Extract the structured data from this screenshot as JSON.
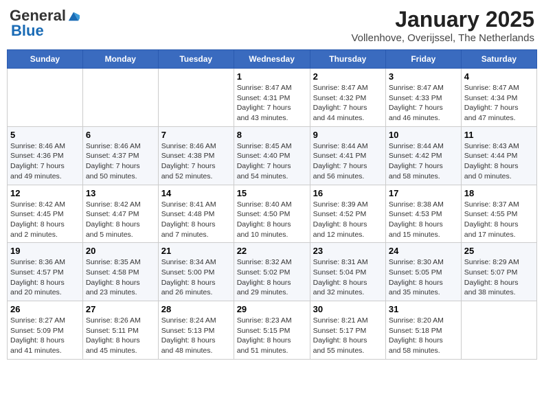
{
  "header": {
    "logo_general": "General",
    "logo_blue": "Blue",
    "title": "January 2025",
    "subtitle": "Vollenhove, Overijssel, The Netherlands"
  },
  "days_of_week": [
    "Sunday",
    "Monday",
    "Tuesday",
    "Wednesday",
    "Thursday",
    "Friday",
    "Saturday"
  ],
  "weeks": [
    [
      {
        "day": "",
        "info": ""
      },
      {
        "day": "",
        "info": ""
      },
      {
        "day": "",
        "info": ""
      },
      {
        "day": "1",
        "info": "Sunrise: 8:47 AM\nSunset: 4:31 PM\nDaylight: 7 hours\nand 43 minutes."
      },
      {
        "day": "2",
        "info": "Sunrise: 8:47 AM\nSunset: 4:32 PM\nDaylight: 7 hours\nand 44 minutes."
      },
      {
        "day": "3",
        "info": "Sunrise: 8:47 AM\nSunset: 4:33 PM\nDaylight: 7 hours\nand 46 minutes."
      },
      {
        "day": "4",
        "info": "Sunrise: 8:47 AM\nSunset: 4:34 PM\nDaylight: 7 hours\nand 47 minutes."
      }
    ],
    [
      {
        "day": "5",
        "info": "Sunrise: 8:46 AM\nSunset: 4:36 PM\nDaylight: 7 hours\nand 49 minutes."
      },
      {
        "day": "6",
        "info": "Sunrise: 8:46 AM\nSunset: 4:37 PM\nDaylight: 7 hours\nand 50 minutes."
      },
      {
        "day": "7",
        "info": "Sunrise: 8:46 AM\nSunset: 4:38 PM\nDaylight: 7 hours\nand 52 minutes."
      },
      {
        "day": "8",
        "info": "Sunrise: 8:45 AM\nSunset: 4:40 PM\nDaylight: 7 hours\nand 54 minutes."
      },
      {
        "day": "9",
        "info": "Sunrise: 8:44 AM\nSunset: 4:41 PM\nDaylight: 7 hours\nand 56 minutes."
      },
      {
        "day": "10",
        "info": "Sunrise: 8:44 AM\nSunset: 4:42 PM\nDaylight: 7 hours\nand 58 minutes."
      },
      {
        "day": "11",
        "info": "Sunrise: 8:43 AM\nSunset: 4:44 PM\nDaylight: 8 hours\nand 0 minutes."
      }
    ],
    [
      {
        "day": "12",
        "info": "Sunrise: 8:42 AM\nSunset: 4:45 PM\nDaylight: 8 hours\nand 2 minutes."
      },
      {
        "day": "13",
        "info": "Sunrise: 8:42 AM\nSunset: 4:47 PM\nDaylight: 8 hours\nand 5 minutes."
      },
      {
        "day": "14",
        "info": "Sunrise: 8:41 AM\nSunset: 4:48 PM\nDaylight: 8 hours\nand 7 minutes."
      },
      {
        "day": "15",
        "info": "Sunrise: 8:40 AM\nSunset: 4:50 PM\nDaylight: 8 hours\nand 10 minutes."
      },
      {
        "day": "16",
        "info": "Sunrise: 8:39 AM\nSunset: 4:52 PM\nDaylight: 8 hours\nand 12 minutes."
      },
      {
        "day": "17",
        "info": "Sunrise: 8:38 AM\nSunset: 4:53 PM\nDaylight: 8 hours\nand 15 minutes."
      },
      {
        "day": "18",
        "info": "Sunrise: 8:37 AM\nSunset: 4:55 PM\nDaylight: 8 hours\nand 17 minutes."
      }
    ],
    [
      {
        "day": "19",
        "info": "Sunrise: 8:36 AM\nSunset: 4:57 PM\nDaylight: 8 hours\nand 20 minutes."
      },
      {
        "day": "20",
        "info": "Sunrise: 8:35 AM\nSunset: 4:58 PM\nDaylight: 8 hours\nand 23 minutes."
      },
      {
        "day": "21",
        "info": "Sunrise: 8:34 AM\nSunset: 5:00 PM\nDaylight: 8 hours\nand 26 minutes."
      },
      {
        "day": "22",
        "info": "Sunrise: 8:32 AM\nSunset: 5:02 PM\nDaylight: 8 hours\nand 29 minutes."
      },
      {
        "day": "23",
        "info": "Sunrise: 8:31 AM\nSunset: 5:04 PM\nDaylight: 8 hours\nand 32 minutes."
      },
      {
        "day": "24",
        "info": "Sunrise: 8:30 AM\nSunset: 5:05 PM\nDaylight: 8 hours\nand 35 minutes."
      },
      {
        "day": "25",
        "info": "Sunrise: 8:29 AM\nSunset: 5:07 PM\nDaylight: 8 hours\nand 38 minutes."
      }
    ],
    [
      {
        "day": "26",
        "info": "Sunrise: 8:27 AM\nSunset: 5:09 PM\nDaylight: 8 hours\nand 41 minutes."
      },
      {
        "day": "27",
        "info": "Sunrise: 8:26 AM\nSunset: 5:11 PM\nDaylight: 8 hours\nand 45 minutes."
      },
      {
        "day": "28",
        "info": "Sunrise: 8:24 AM\nSunset: 5:13 PM\nDaylight: 8 hours\nand 48 minutes."
      },
      {
        "day": "29",
        "info": "Sunrise: 8:23 AM\nSunset: 5:15 PM\nDaylight: 8 hours\nand 51 minutes."
      },
      {
        "day": "30",
        "info": "Sunrise: 8:21 AM\nSunset: 5:17 PM\nDaylight: 8 hours\nand 55 minutes."
      },
      {
        "day": "31",
        "info": "Sunrise: 8:20 AM\nSunset: 5:18 PM\nDaylight: 8 hours\nand 58 minutes."
      },
      {
        "day": "",
        "info": ""
      }
    ]
  ]
}
